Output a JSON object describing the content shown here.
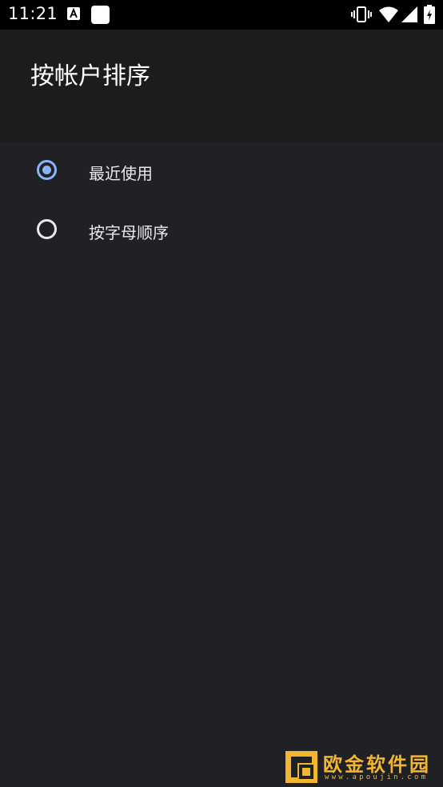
{
  "status_bar": {
    "time": "11:21",
    "icons": [
      "text-a-icon",
      "app-square-icon",
      "vibrate-icon",
      "wifi-icon",
      "signal-icon",
      "battery-icon"
    ]
  },
  "header": {
    "title": "按帐户排序"
  },
  "options": [
    {
      "label": "最近使用",
      "checked": true
    },
    {
      "label": "按字母顺序",
      "checked": false
    }
  ],
  "watermark": {
    "text": "欧金软件园",
    "sub": "www.apoujin.com"
  },
  "colors": {
    "accent": "#8ab4f8",
    "background": "#202124",
    "header_bg": "#1b1c1e",
    "status_bg": "#000000"
  }
}
